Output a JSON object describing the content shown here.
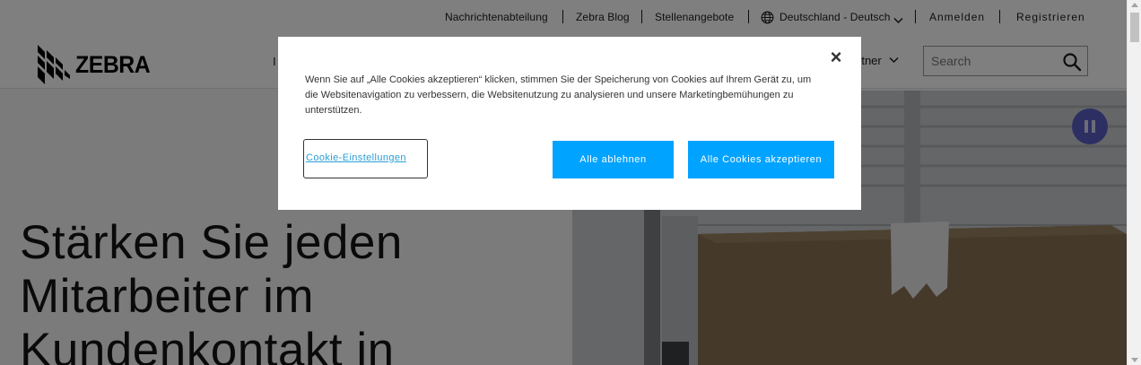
{
  "utility_nav": {
    "newsroom": "Nachrichtenabteilung",
    "blog": "Zebra Blog",
    "jobs": "Stellenangebote",
    "language": "Deutschland - Deutsch",
    "login": "Anmelden",
    "register": "Registrieren"
  },
  "main_nav": {
    "logo": "ZEBRA",
    "partial_item": "I",
    "partner_item": "rtner",
    "search": {
      "placeholder": "Search",
      "value": ""
    }
  },
  "hero": {
    "title": "Stärken Sie jeden Mitarbeiter im Kundenkontakt in"
  },
  "cookie_dialog": {
    "text": "Wenn Sie auf „Alle Cookies akzeptieren“ klicken, stimmen Sie der Speicherung von Cookies auf Ihrem Gerät zu, um die Websitenavigation zu verbessern, die Websitenutzung zu analysieren und unsere Marketingbemühungen zu unterstützen.",
    "settings_label": "Cookie-Einstellungen",
    "reject_label": "Alle ablehnen",
    "accept_label": "Alle Cookies akzeptieren",
    "close_symbol": "×"
  },
  "colors": {
    "accent": "#00a3ff",
    "link": "#2a9fd6",
    "pause_button": "#5b5fc7",
    "overlay": "rgba(0,0,0,0.5)"
  },
  "icons": [
    "globe-icon",
    "chevron-down-icon",
    "search-icon",
    "close-icon",
    "pause-icon",
    "zebra-logo-icon"
  ]
}
